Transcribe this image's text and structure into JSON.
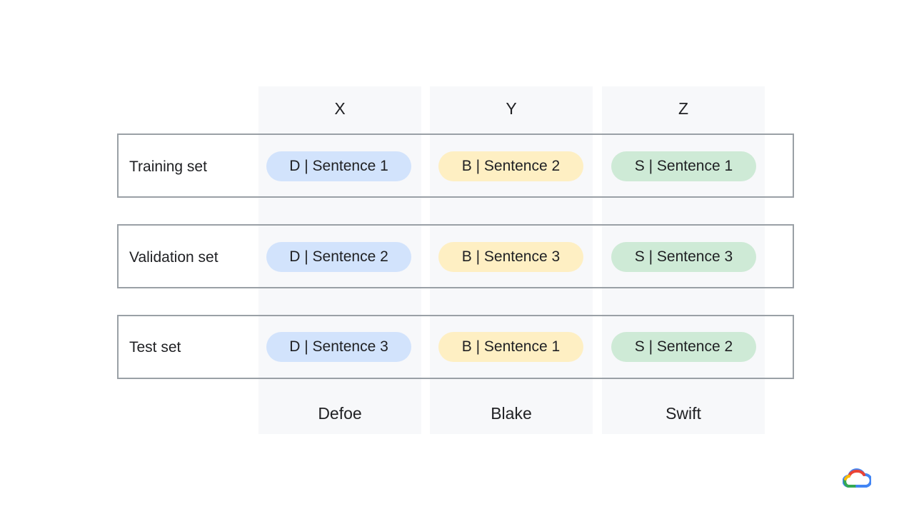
{
  "columns": [
    {
      "header": "X",
      "footer": "Defoe",
      "color": "#d2e3fc"
    },
    {
      "header": "Y",
      "footer": "Blake",
      "color": "#feefc3"
    },
    {
      "header": "Z",
      "footer": "Swift",
      "color": "#ceead6"
    }
  ],
  "rows": [
    {
      "label": "Training set",
      "cells": [
        "D | Sentence 1",
        "B | Sentence 2",
        "S | Sentence 1"
      ]
    },
    {
      "label": "Validation set",
      "cells": [
        "D | Sentence 2",
        "B | Sentence 3",
        "S | Sentence 3"
      ]
    },
    {
      "label": "Test set",
      "cells": [
        "D | Sentence 3",
        "B | Sentence 1",
        "S | Sentence 2"
      ]
    }
  ],
  "logo": {
    "icon": "google-cloud-logo-icon"
  }
}
